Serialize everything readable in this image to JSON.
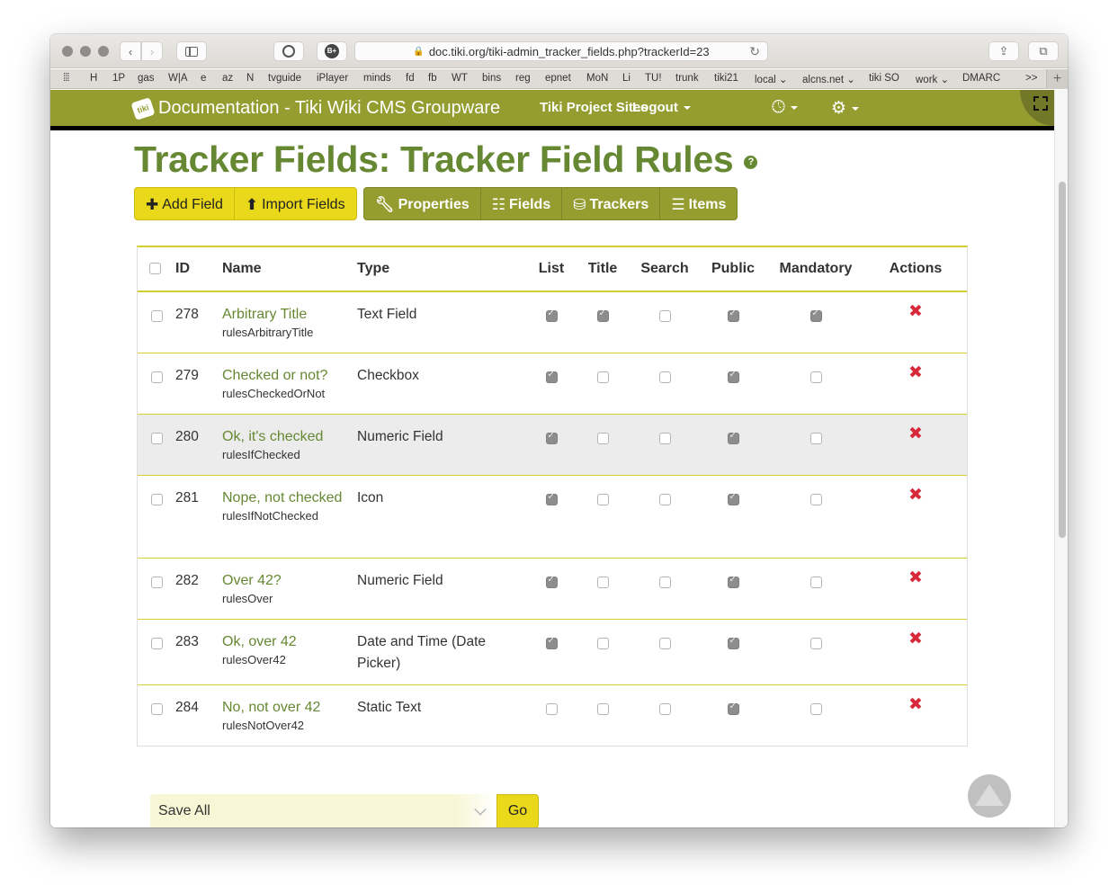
{
  "browser": {
    "url": "doc.tiki.org/tiki-admin_tracker_fields.php?trackerId=23",
    "bookmarks": [
      "H",
      "1P",
      "gas",
      "W|A",
      "e",
      "az",
      "N",
      "tvguide",
      "iPlayer",
      "minds",
      "fd",
      "fb",
      "WT",
      "bins",
      "reg",
      "epnet",
      "MoN",
      "Li",
      "TU!",
      "trunk",
      "tiki21",
      "local ⌄",
      "alcns.net ⌄",
      "tiki SO",
      "work ⌄",
      "DMARC"
    ],
    "overflow_label": ">>",
    "new_tab_label": "+"
  },
  "navbar": {
    "logo_text": "tiki",
    "site_title": "Documentation - Tiki Wiki CMS Groupware",
    "project_sites_label": "Tiki Project Sites",
    "logout_label": "Logout",
    "recent_icon": "clock-icon",
    "admin_icon": "gears-icon"
  },
  "page": {
    "title": "Tracker Fields: Tracker Field Rules",
    "help_icon_label": "?"
  },
  "toolbar": {
    "add_field": "Add Field",
    "import_fields": "Import Fields",
    "properties": "Properties",
    "fields": "Fields",
    "trackers": "Trackers",
    "items": "Items"
  },
  "table": {
    "columns": [
      "ID",
      "Name",
      "Type",
      "List",
      "Title",
      "Search",
      "Public",
      "Mandatory",
      "Actions"
    ],
    "rows": [
      {
        "id": "278",
        "name": "Arbitrary Title",
        "perm": "rulesArbitraryTitle",
        "type": "Text Field",
        "list": true,
        "title": true,
        "search": false,
        "public": true,
        "mandatory": true
      },
      {
        "id": "279",
        "name": "Checked or not?",
        "perm": "rulesCheckedOrNot",
        "type": "Checkbox",
        "list": true,
        "title": false,
        "search": false,
        "public": true,
        "mandatory": false
      },
      {
        "id": "280",
        "name": "Ok, it's checked",
        "perm": "rulesIfChecked",
        "type": "Numeric Field",
        "list": true,
        "title": false,
        "search": false,
        "public": true,
        "mandatory": false
      },
      {
        "id": "281",
        "name": "Nope, not checked",
        "perm": "rulesIfNotChecked",
        "type": "Icon",
        "list": true,
        "title": false,
        "search": false,
        "public": true,
        "mandatory": false
      },
      {
        "id": "282",
        "name": "Over 42?",
        "perm": "rulesOver",
        "type": "Numeric Field",
        "list": true,
        "title": false,
        "search": false,
        "public": true,
        "mandatory": false
      },
      {
        "id": "283",
        "name": "Ok, over 42",
        "perm": "rulesOver42",
        "type": "Date and Time (Date Picker)",
        "list": true,
        "title": false,
        "search": false,
        "public": true,
        "mandatory": false
      },
      {
        "id": "284",
        "name": "No, not over 42",
        "perm": "rulesNotOver42",
        "type": "Static Text",
        "list": false,
        "title": false,
        "search": false,
        "public": true,
        "mandatory": false
      }
    ],
    "delete_icon": "✖"
  },
  "bulk_action": {
    "selected": "Save All",
    "go_label": "Go"
  },
  "colors": {
    "brand_olive": "#959d31",
    "title_green": "#668832",
    "accent_yellow": "#ead91a",
    "delete_red": "#d8293b"
  }
}
